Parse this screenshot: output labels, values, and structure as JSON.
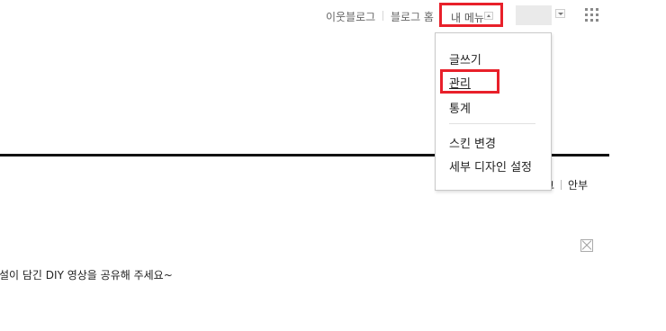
{
  "topnav": {
    "neighbor_blog": "이웃블로그",
    "blog_home": "블로그 홈",
    "my_menu": "내 메뉴"
  },
  "icons": {
    "my_menu_caret": "caret-up-icon",
    "account_caret": "caret-down-icon",
    "apps_grid": "grid-icon",
    "close": "close-icon"
  },
  "dropdown": {
    "items": [
      {
        "label": "글쓰기"
      },
      {
        "label": "관리"
      },
      {
        "label": "통계"
      },
      {
        "label": "스킨 변경"
      },
      {
        "label": "세부 디자인 설정"
      }
    ]
  },
  "page": {
    "links": [
      "그",
      "안부"
    ],
    "body_text": "설이 담긴 DIY 영상을 공유해 주세요~"
  },
  "colors": {
    "highlight_border": "#e8202a",
    "divider": "#111111"
  }
}
